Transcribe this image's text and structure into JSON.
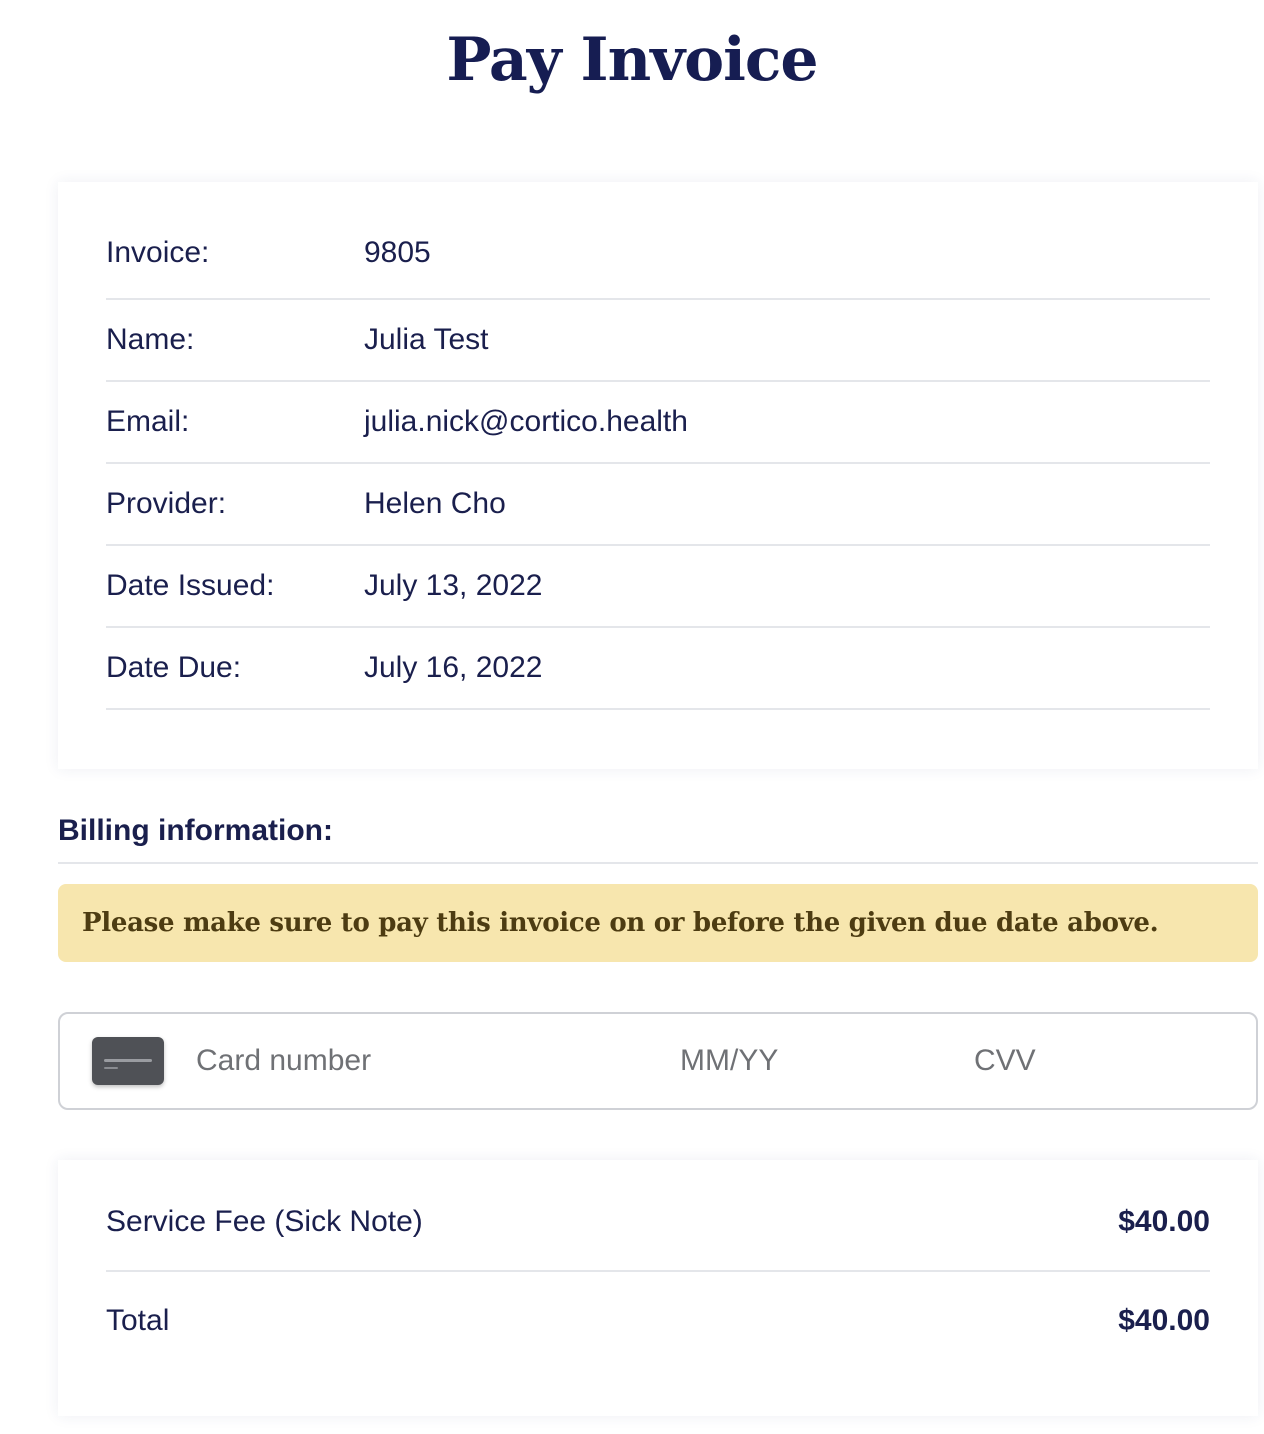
{
  "page": {
    "title": "Pay Invoice"
  },
  "invoice_details": [
    {
      "label": "Invoice:",
      "value": "9805"
    },
    {
      "label": "Name:",
      "value": "Julia Test"
    },
    {
      "label": "Email:",
      "value": "julia.nick@cortico.health"
    },
    {
      "label": "Provider:",
      "value": "Helen Cho"
    },
    {
      "label": "Date Issued:",
      "value": "July 13, 2022"
    },
    {
      "label": "Date Due:",
      "value": "July 16, 2022"
    }
  ],
  "billing": {
    "heading": "Billing information:",
    "notice": "Please make sure to pay this invoice on or before the given due date above.",
    "card_icon": "credit-card-icon",
    "card_number_placeholder": "Card number",
    "expiry_placeholder": "MM/YY",
    "cvv_placeholder": "CVV"
  },
  "totals": {
    "fee_label": "Service Fee (Sick Note)",
    "fee_amount": "$40.00",
    "total_label": "Total",
    "total_amount": "$40.00"
  },
  "colors": {
    "heading": "#161d52",
    "text": "#1a1f4d",
    "notice_bg": "#f7e6ae",
    "notice_text": "#4d3c12",
    "divider": "#e4e6ea"
  }
}
